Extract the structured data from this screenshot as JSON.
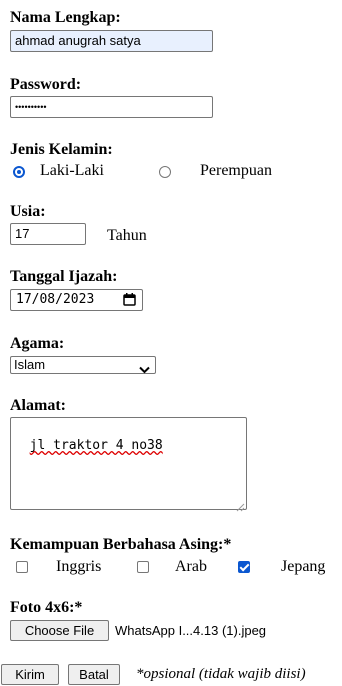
{
  "nama": {
    "label": "Nama Lengkap:",
    "value": "ahmad anugrah satya"
  },
  "password": {
    "label": "Password:",
    "value": "••••••••••"
  },
  "jenis_kelamin": {
    "label": "Jenis Kelamin:",
    "options": [
      "Laki-Laki",
      "Perempuan"
    ],
    "selected": "Laki-Laki"
  },
  "usia": {
    "label": "Usia:",
    "value": "17",
    "unit": "Tahun"
  },
  "tanggal_ijazah": {
    "label": "Tanggal Ijazah:",
    "value": "17/08/2023",
    "icon": "calendar-icon"
  },
  "agama": {
    "label": "Agama:",
    "selected": "Islam",
    "icon": "chevron-down-icon"
  },
  "alamat": {
    "label": "Alamat:",
    "value": "jl traktor 4 no38"
  },
  "bahasa": {
    "label": "Kemampuan Berbahasa Asing:*",
    "options": [
      {
        "label": "Inggris",
        "checked": false
      },
      {
        "label": "Arab",
        "checked": false
      },
      {
        "label": "Jepang",
        "checked": true
      }
    ]
  },
  "foto": {
    "label": "Foto 4x6:*",
    "button": "Choose File",
    "filename": "WhatsApp I...4.13 (1).jpeg"
  },
  "actions": {
    "submit": "Kirim",
    "reset": "Batal",
    "note": "*opsional (tidak wajib diisi)"
  },
  "colors": {
    "accent": "#0b57d0",
    "autofill": "#e8f0fe",
    "border": "#767676"
  }
}
